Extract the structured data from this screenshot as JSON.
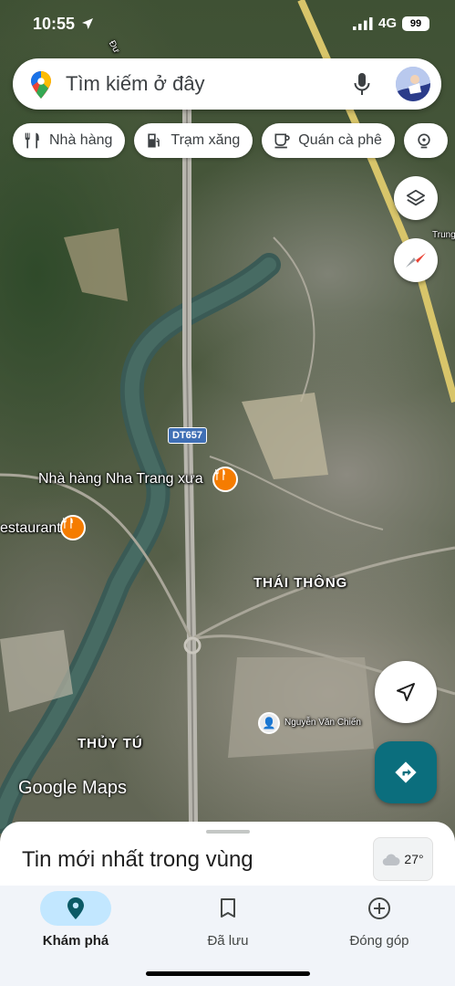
{
  "status_bar": {
    "time": "10:55",
    "network": "4G",
    "battery": "99"
  },
  "search": {
    "placeholder": "Tìm kiếm ở đây"
  },
  "chips": [
    {
      "label": "Nhà hàng",
      "icon": "fork-knife-icon"
    },
    {
      "label": "Trạm xăng",
      "icon": "gas-station-icon"
    },
    {
      "label": "Quán cà phê",
      "icon": "coffee-cup-icon"
    }
  ],
  "map": {
    "road_shield": "DT657",
    "districts": {
      "thai_thong": "THÁI THÔNG",
      "thuy_tu": "THỦY TÚ"
    },
    "pois": {
      "restaurant_1": "Nhà hàng Nha Trang xưa",
      "restaurant_2": "estaurant",
      "person": "Nguyễn Văn Chiến",
      "street_top": "Đư",
      "street_right": "Trung"
    }
  },
  "logo": {
    "text": "Google Maps"
  },
  "sheet": {
    "title": "Tin mới nhất trong vùng",
    "weather": "27°"
  },
  "nav": [
    {
      "label": "Khám phá",
      "icon": "explore-pin-icon",
      "active": true
    },
    {
      "label": "Đã lưu",
      "icon": "bookmark-icon",
      "active": false
    },
    {
      "label": "Đóng góp",
      "icon": "add-circle-icon",
      "active": false
    }
  ],
  "colors": {
    "accent": "#0b6e7d",
    "nav_active": "#c2e7ff",
    "poi": "#f57c00"
  }
}
